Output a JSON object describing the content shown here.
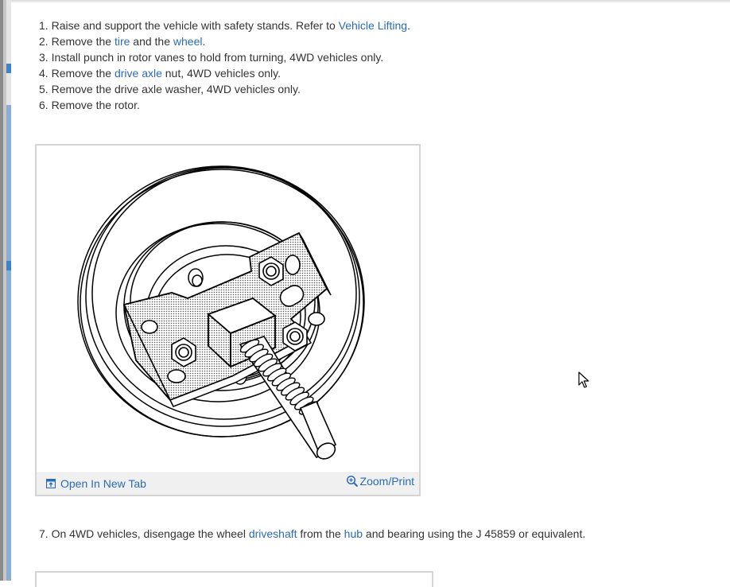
{
  "steps": [
    {
      "num": "1.",
      "pre": "Raise and support the vehicle with safety stands. Refer to ",
      "link": "Vehicle Lifting",
      "post": "."
    },
    {
      "num": "2.",
      "pre": "Remove the ",
      "link": "tire",
      "mid": " and the ",
      "link2": "wheel",
      "post": "."
    },
    {
      "num": "3.",
      "pre": "Install punch in rotor vanes to hold from turning, 4WD vehicles only."
    },
    {
      "num": "4.",
      "pre": "Remove the ",
      "link": "drive axle",
      "post": " nut, 4WD vehicles only."
    },
    {
      "num": "5.",
      "pre": "Remove the drive axle washer, 4WD vehicles only."
    },
    {
      "num": "6.",
      "pre": "Remove the rotor."
    }
  ],
  "figure": {
    "open_tab_label": "Open In New Tab",
    "zoom_label": "Zoom/Print"
  },
  "step7": {
    "num": "7.",
    "pre": "On 4WD vehicles, disengage the wheel ",
    "link": "driveshaft",
    "mid": " from the ",
    "link2": "hub",
    "post": " and bearing using the J 45859 or equivalent."
  },
  "icons": {
    "open_tab": "open-new-tab-icon",
    "zoom": "zoom-in-icon",
    "cursor": "mouse-pointer-icon"
  },
  "colors": {
    "link": "#2a6ab8",
    "text": "#333333",
    "sidebar_accent": "#3e82c8"
  }
}
